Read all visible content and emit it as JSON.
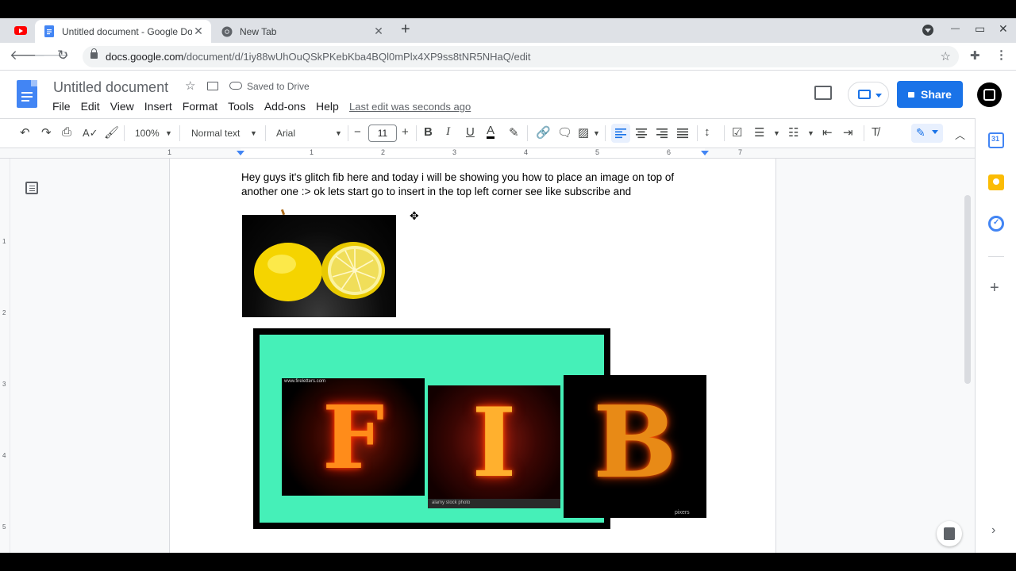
{
  "browser": {
    "tabs": [
      {
        "title": "Untitled document - Google Docs",
        "active": true
      },
      {
        "title": "New Tab",
        "active": false
      }
    ],
    "new_tab_symbol": "+",
    "close_symbol": "✕",
    "url_host": "docs.google.com",
    "url_path": "/document/d/1iy88wUhOuQSkPKebKba4BQl0mPlx4XP9ss8tNR5NHaQ/edit",
    "window_controls": {
      "minimize": "—",
      "restore": "▭",
      "close": "✕"
    }
  },
  "docs": {
    "title": "Untitled document",
    "saved_status": "Saved to Drive",
    "menu": [
      "File",
      "Edit",
      "View",
      "Insert",
      "Format",
      "Tools",
      "Add-ons",
      "Help"
    ],
    "last_edit": "Last edit was seconds ago",
    "share_label": "Share",
    "colors": {
      "accent": "#1a73e8",
      "docs_blue": "#4285f4"
    }
  },
  "toolbar": {
    "zoom": "100%",
    "style": "Normal text",
    "font": "Arial",
    "font_size": "11",
    "bold": "B",
    "italic": "I",
    "underline": "U",
    "text_color": "A",
    "minus": "−",
    "plus": "+"
  },
  "ruler": {
    "numbers": [
      "1",
      "1",
      "2",
      "3",
      "4",
      "5",
      "6",
      "7"
    ],
    "vertical_numbers": [
      "1",
      "2",
      "3",
      "4",
      "5"
    ]
  },
  "document": {
    "body_text": "Hey guys it's glitch fib here and today i will  be showing you how to place an image on top of another one :> ok lets start go to insert in the top left corner see like subscribe and",
    "move_cursor": "✥",
    "images": {
      "letter_f": "F",
      "letter_i": "I",
      "letter_b": "B",
      "watermark_alamy": "alamy stock photo",
      "watermark_pixers": "pixers",
      "watermark_f": "www.fireletters.com"
    }
  }
}
